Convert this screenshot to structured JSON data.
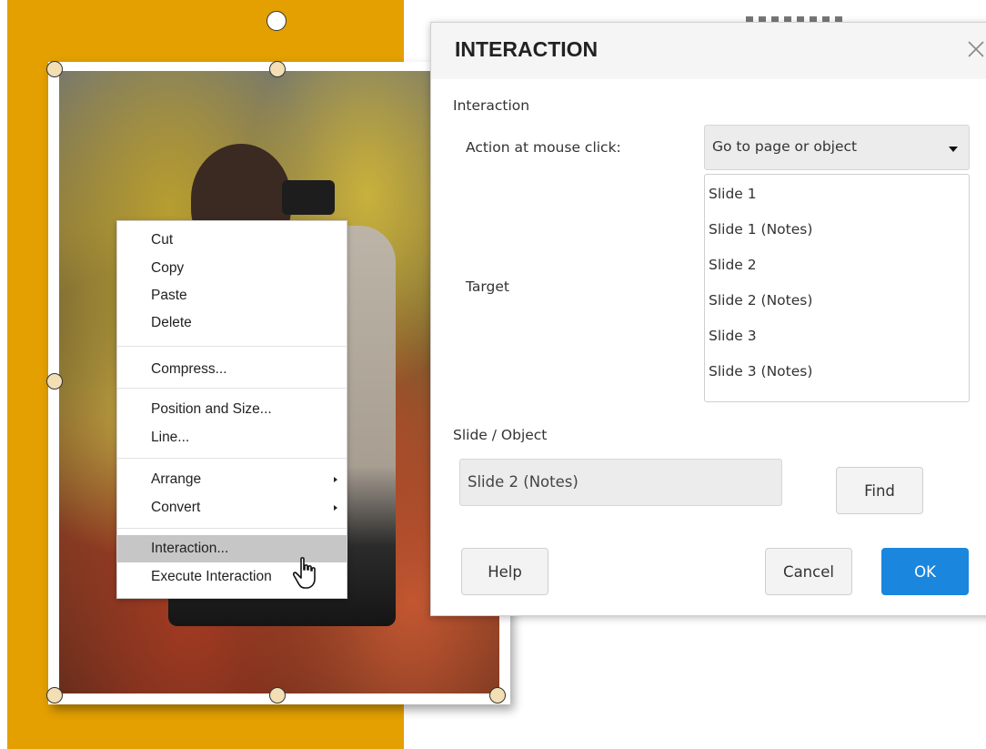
{
  "context_menu": {
    "items": [
      {
        "label": "Cut"
      },
      {
        "label": "Copy"
      },
      {
        "label": "Paste"
      },
      {
        "label": "Delete"
      },
      {
        "label": "Compress..."
      },
      {
        "label": "Position and Size..."
      },
      {
        "label": "Line..."
      },
      {
        "label": "Arrange"
      },
      {
        "label": "Convert"
      },
      {
        "label": "Interaction..."
      },
      {
        "label": "Execute Interaction"
      }
    ]
  },
  "dialog": {
    "title": "INTERACTION",
    "section_label": "Interaction",
    "action_label": "Action at mouse click:",
    "action_value": "Go to page or object",
    "target_label": "Target",
    "targets": [
      "Slide 1",
      "Slide 1 (Notes)",
      "Slide 2",
      "Slide 2 (Notes)",
      "Slide 3",
      "Slide 3 (Notes)"
    ],
    "slide_object_label": "Slide / Object",
    "slide_object_value": "Slide 2 (Notes)",
    "buttons": {
      "find": "Find",
      "help": "Help",
      "cancel": "Cancel",
      "ok": "OK"
    }
  },
  "colors": {
    "accent": "#1a86dd",
    "slide_background": "#e3a000",
    "menu_highlight": "#c6c6c6"
  }
}
